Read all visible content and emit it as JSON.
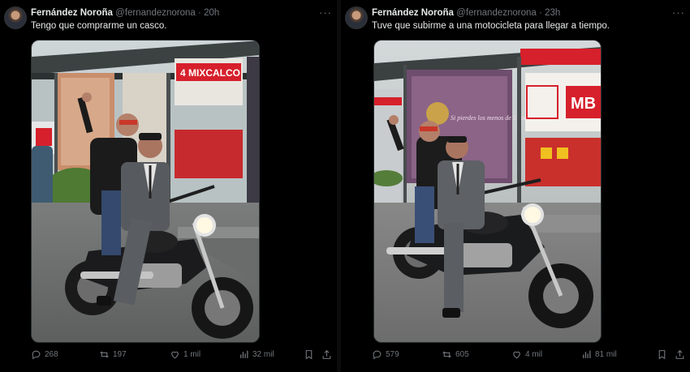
{
  "tweets": [
    {
      "author_name": "Fernández Noroña",
      "handle": "@fernandeznorona",
      "separator": "·",
      "time": "20h",
      "more": "···",
      "text": "Tengo que comprarme un casco.",
      "media_sign": "4  MIXCALCO",
      "stats": {
        "replies": "268",
        "reposts": "197",
        "likes": "1 mil",
        "views": "32 mil"
      }
    },
    {
      "author_name": "Fernández Noroña",
      "handle": "@fernandeznorona",
      "separator": "·",
      "time": "23h",
      "more": "···",
      "text": "Tuve que subirme a una motocicleta para llegar a tiempo.",
      "media_sign": "MB",
      "media_poster": "Si pierdes los menos de 5 minutos",
      "stats": {
        "replies": "579",
        "reposts": "605",
        "likes": "4 mil",
        "views": "81 mil"
      }
    }
  ],
  "icons": [
    "reply-icon",
    "repost-icon",
    "like-icon",
    "views-icon",
    "bookmark-icon",
    "share-icon",
    "more-icon"
  ],
  "colors": {
    "background": "#000000",
    "text": "#e7e9ea",
    "muted": "#71767b",
    "metrobus_red": "#d6202b"
  }
}
